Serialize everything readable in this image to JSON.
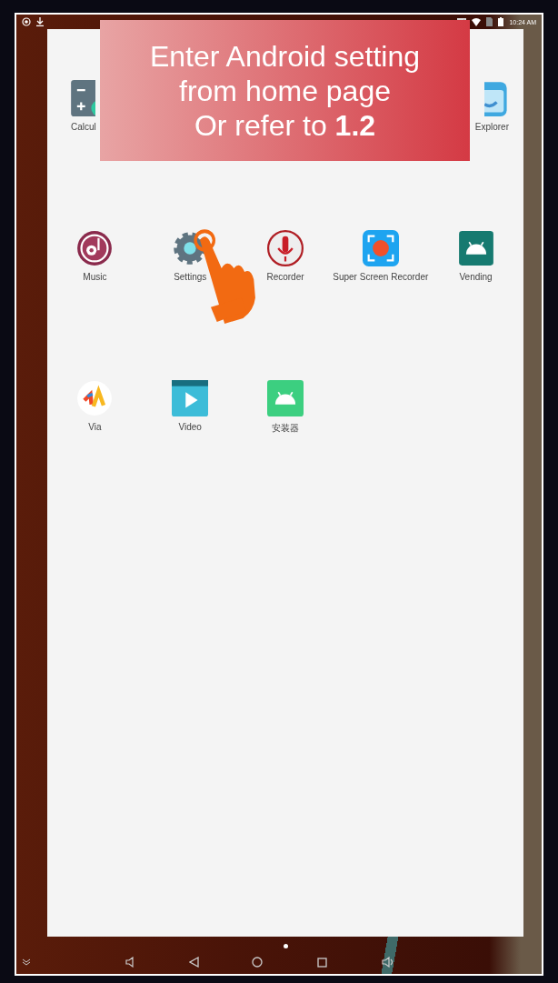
{
  "status_bar": {
    "time": "10:24 AM"
  },
  "app_rows": [
    [
      {
        "kind": "calculator",
        "label": "Calcul"
      },
      {
        "kind": "explorer",
        "label": "Explorer"
      }
    ],
    [
      {
        "kind": "music",
        "label": "Music"
      },
      {
        "kind": "settings",
        "label": "Settings"
      },
      {
        "kind": "recorder",
        "label": "Recorder"
      },
      {
        "kind": "screen-recorder",
        "label": "Super Screen Recorder"
      },
      {
        "kind": "vending",
        "label": "Vending"
      }
    ],
    [
      {
        "kind": "via",
        "label": "Via"
      },
      {
        "kind": "video",
        "label": "Video"
      },
      {
        "kind": "installer",
        "label": "安装器"
      }
    ]
  ],
  "banner": {
    "lines": [
      "Enter Android setting",
      "from home page",
      "Or refer to **1.2**"
    ]
  }
}
